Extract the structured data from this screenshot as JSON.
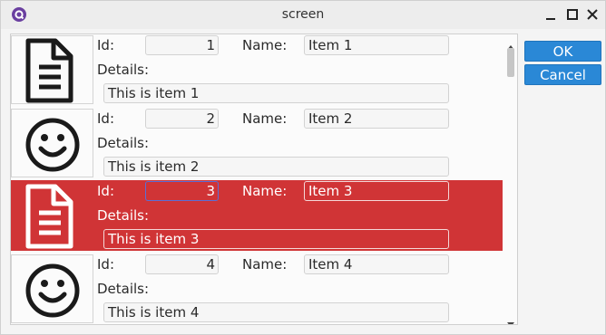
{
  "window": {
    "title": "screen"
  },
  "labels": {
    "id": "Id:",
    "name": "Name:",
    "details": "Details:"
  },
  "items": [
    {
      "icon": "document-icon",
      "id": "1",
      "name": "Item 1",
      "details": "This is item 1",
      "selected": false
    },
    {
      "icon": "smiley-icon",
      "id": "2",
      "name": "Item 2",
      "details": "This is item 2",
      "selected": false
    },
    {
      "icon": "document-icon",
      "id": "3",
      "name": "Item 3",
      "details": "This is item 3",
      "selected": true
    },
    {
      "icon": "smiley-icon",
      "id": "4",
      "name": "Item 4",
      "details": "This is item 4",
      "selected": false
    }
  ],
  "buttons": {
    "ok": "OK",
    "cancel": "Cancel"
  },
  "colors": {
    "selection": "#d03436",
    "button": "#2a88d6",
    "focus": "#5a6fd6"
  }
}
